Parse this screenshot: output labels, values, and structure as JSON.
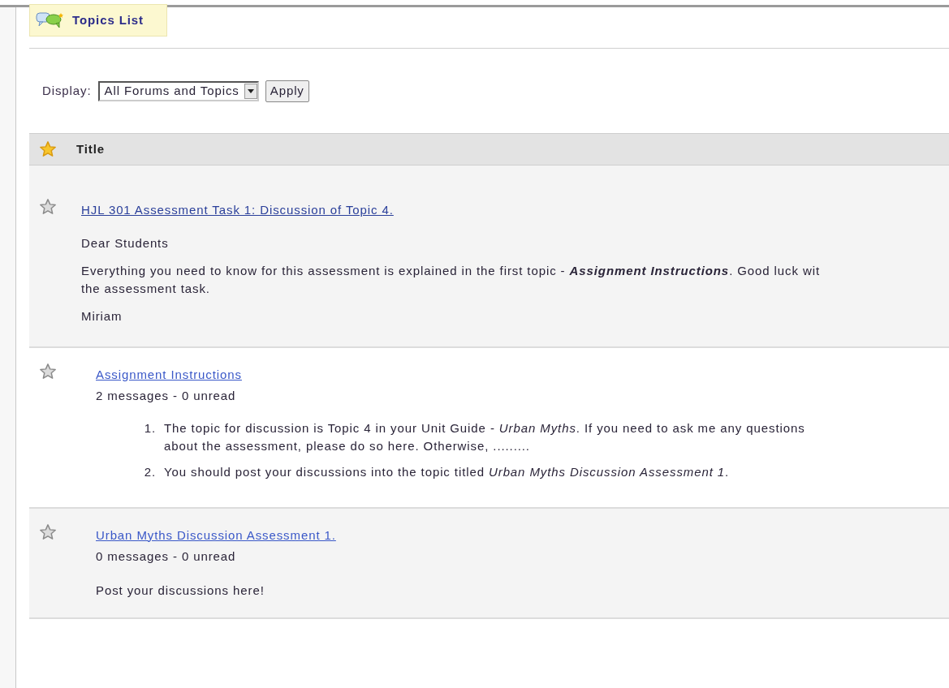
{
  "header": {
    "title": "Topics List"
  },
  "display": {
    "label": "Display:",
    "value": "All Forums and Topics",
    "button": "Apply"
  },
  "table": {
    "columns": [
      {
        "title": "Title",
        "starred": true
      }
    ],
    "rows": [
      {
        "kind": "forum",
        "starred": false,
        "title": "HJL 301 Assessment Task 1: Discussion of Topic 4.",
        "paragraphs": [
          [
            "Dear Students"
          ],
          [
            "Everything you need to know for this assessment is explained in the first topic - **Assignment Instructions**. Good luck wit",
            "the assessment task."
          ],
          [
            "Miriam"
          ]
        ]
      },
      {
        "kind": "topic",
        "starred": false,
        "title": "Assignment Instructions",
        "meta": "2 messages - 0 unread",
        "list": [
          {
            "num": "1.",
            "lines": [
              "The topic for discussion is Topic 4 in your Unit Guide - *Urban Myths*. If you need to ask me any questions",
              "about the assessment, please do so here. Otherwise, ........."
            ]
          },
          {
            "num": "2.",
            "lines": [
              "You should post your discussions into the topic titled *Urban Myths Discussion Assessment 1*."
            ]
          }
        ]
      },
      {
        "kind": "topic",
        "starred": false,
        "title": "Urban Myths Discussion Assessment 1.",
        "meta": "0 messages - 0 unread",
        "paragraphs": [
          [
            "Post your discussions here!"
          ]
        ]
      }
    ]
  }
}
